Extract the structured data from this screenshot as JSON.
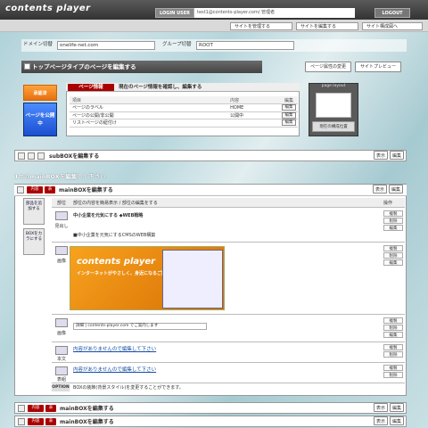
{
  "header": {
    "logo": "contents player",
    "login_label": "LOGIN USER",
    "login_user": "test1@contents-player.com/ 管理者",
    "logout": "LOGOUT"
  },
  "nav": {
    "items": [
      "サイトを管理する",
      "サイトを編集する",
      "サイト構成図へ"
    ]
  },
  "domain": {
    "label": "ドメイン切替",
    "value": "onelife-net.com",
    "group_label": "グループ切替",
    "group_value": "ROOT"
  },
  "page_edit": {
    "title": "トップページタイプのページを編集する",
    "attr_button": "ページ属性の変更",
    "preview_button": "サイトプレビュー"
  },
  "status": {
    "approved": "承認済",
    "publish": "ページを公開中"
  },
  "page_info": {
    "tag": "ページ情報",
    "desc": "現在のページ情報を確認し、編集する",
    "headers": [
      "項目",
      "内容",
      "編集"
    ],
    "rows": [
      {
        "item": "ページのラベル",
        "value": "HOME",
        "edit": "編集"
      },
      {
        "item": "ページの公開/非公開",
        "value": "公開中",
        "edit": "編集"
      },
      {
        "item": "リストページの紐付け",
        "value": "",
        "edit": "編集"
      }
    ]
  },
  "page_layout": {
    "head": "page layout",
    "button": "現在の構成位置"
  },
  "subbox": {
    "title": "subBOXを編集する",
    "b1": "表示",
    "b2": "編集"
  },
  "hint": "1つのmainBOXを編集して下さい",
  "mainbox": {
    "title": "mainBOXを編集する",
    "pill1": "内容",
    "pill2": "表",
    "b1": "表示",
    "b2": "編集",
    "headers": [
      "部位",
      "部位の内容を簡易表示 / 部位の編集をする",
      "操作"
    ],
    "tools": [
      "部品を追加する",
      "BOXをカラにする"
    ],
    "rows": [
      {
        "tag": "見出し",
        "text": "中小企業を元気にする ◆WEB戦略",
        "sub": "■中小企業を元気にするCMSのWEB構築"
      },
      {
        "tag": "画像",
        "text": "contents player",
        "sub": "インターネットがやさしく、身近になるご提案。"
      },
      {
        "tag": "画像",
        "text": "詳細 | contents-player.com でご案内します"
      },
      {
        "tag": "本文",
        "text": "内容がありませんので編集して下さい"
      },
      {
        "tag": "表組",
        "text": "内容がありませんので編集して下さい"
      }
    ],
    "ctl": [
      "複製",
      "削除",
      "編集"
    ],
    "option_label": "OPTION",
    "option_text": "BOXの装飾(背景スタイル)を変更することができます。"
  },
  "mainbox2": {
    "title": "mainBOXを編集する",
    "pill1": "内容",
    "pill2": "表",
    "b1": "表示",
    "b2": "編集"
  },
  "mainbox3": {
    "title": "mainBOXを編集する",
    "pill1": "内容",
    "pill2": "表",
    "b1": "表示",
    "b2": "編集"
  },
  "colors": {
    "accent": "#aa0000",
    "approved": "#f08a20",
    "publish": "#2a5fd8",
    "link": "#134ea4"
  }
}
